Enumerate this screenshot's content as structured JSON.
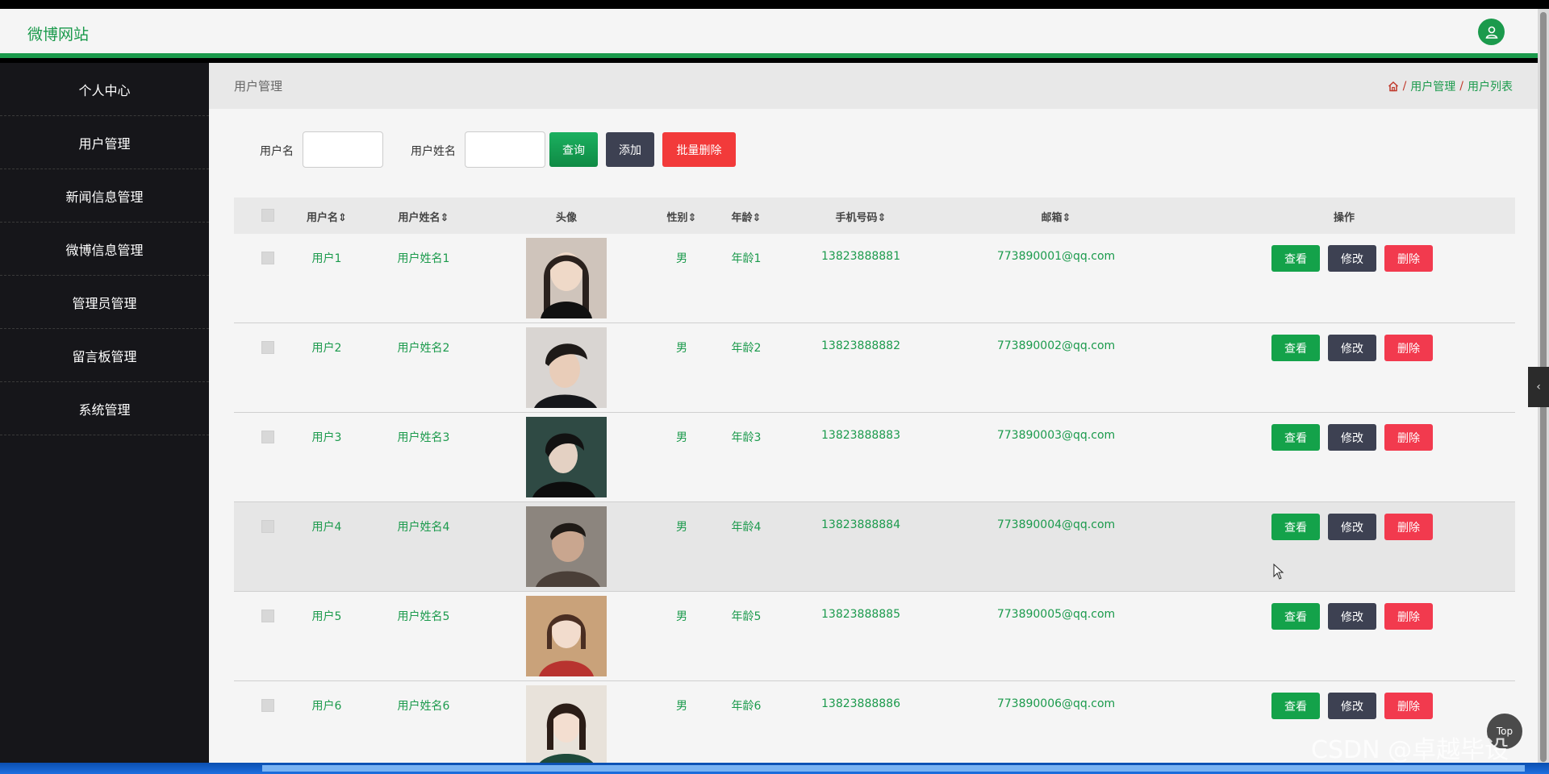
{
  "header": {
    "site_title": "微博网站"
  },
  "sidebar": {
    "items": [
      "个人中心",
      "用户管理",
      "新闻信息管理",
      "微博信息管理",
      "管理员管理",
      "留言板管理",
      "系统管理"
    ]
  },
  "breadcrumb": {
    "title": "用户管理",
    "crumb1": "用户管理",
    "crumb2": "用户列表",
    "sep": "/"
  },
  "search": {
    "username_label": "用户名",
    "realname_label": "用户姓名",
    "username_value": "",
    "realname_value": "",
    "query_label": "查询",
    "add_label": "添加",
    "batch_delete_label": "批量删除"
  },
  "table": {
    "columns": [
      "用户名",
      "用户姓名",
      "头像",
      "性别",
      "年龄",
      "手机号码",
      "邮箱",
      "操作"
    ],
    "sort_glyph": "⇕",
    "rows": [
      {
        "username": "用户1",
        "realname": "用户姓名1",
        "gender": "男",
        "age": "年龄1",
        "phone": "13823888881",
        "email": "773890001@qq.com"
      },
      {
        "username": "用户2",
        "realname": "用户姓名2",
        "gender": "男",
        "age": "年龄2",
        "phone": "13823888882",
        "email": "773890002@qq.com"
      },
      {
        "username": "用户3",
        "realname": "用户姓名3",
        "gender": "男",
        "age": "年龄3",
        "phone": "13823888883",
        "email": "773890003@qq.com"
      },
      {
        "username": "用户4",
        "realname": "用户姓名4",
        "gender": "男",
        "age": "年龄4",
        "phone": "13823888884",
        "email": "773890004@qq.com"
      },
      {
        "username": "用户5",
        "realname": "用户姓名5",
        "gender": "男",
        "age": "年龄5",
        "phone": "13823888885",
        "email": "773890005@qq.com"
      },
      {
        "username": "用户6",
        "realname": "用户姓名6",
        "gender": "男",
        "age": "年龄6",
        "phone": "13823888886",
        "email": "773890006@qq.com"
      }
    ],
    "actions": {
      "view": "查看",
      "edit": "修改",
      "delete": "删除"
    }
  },
  "top_button": "Top",
  "watermark": "CSDN @卓越毕设",
  "colors": {
    "accent": "#1b9a4c",
    "dark": "#3d4152",
    "danger": "#f23a3a"
  }
}
